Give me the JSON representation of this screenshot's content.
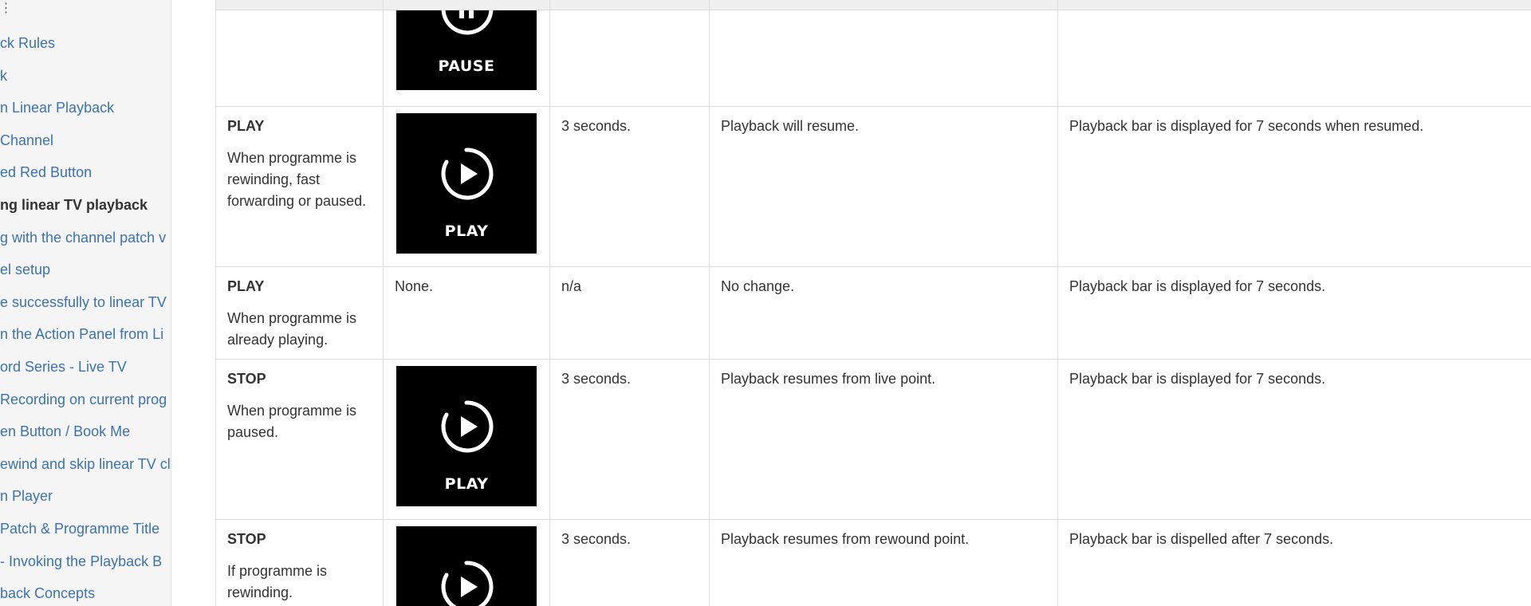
{
  "sidebar": {
    "items": [
      {
        "label": "ck Rules"
      },
      {
        "label": "k"
      },
      {
        "label": "n Linear Playback"
      },
      {
        "label": "Channel"
      },
      {
        "label": "ed Red Button"
      },
      {
        "label": "ng linear TV playback",
        "active": true
      },
      {
        "label": "g with the channel patch v"
      },
      {
        "label": "el setup"
      },
      {
        "label": "e successfully to linear TV"
      },
      {
        "label": "n the Action Panel from Li"
      },
      {
        "label": "ord Series - Live TV"
      },
      {
        "label": "Recording on current prog"
      },
      {
        "label": "en Button / Book Me"
      },
      {
        "label": "ewind and skip linear TV cl"
      },
      {
        "label": "n Player"
      },
      {
        "label": " Patch & Programme Title"
      },
      {
        " label": "",
        "label": " - Invoking the Playback B"
      },
      {
        "label": "back Concepts"
      }
    ],
    "handle": "⋮"
  },
  "table": {
    "rows": [
      {
        "condition_title": "",
        "condition_desc": "",
        "icon": {
          "name": "pause-icon",
          "label": "PAUSE"
        },
        "delay": "",
        "result": "",
        "playback_bar": ""
      },
      {
        "condition_title": "PLAY",
        "condition_desc": "When programme is rewinding, fast forwarding or paused.",
        "icon": {
          "name": "play-icon",
          "label": "PLAY"
        },
        "delay": "3 seconds.",
        "result": "Playback will resume.",
        "playback_bar": "Playback bar is displayed for 7 seconds when resumed."
      },
      {
        "condition_title": "PLAY",
        "condition_desc": "When programme is already playing.",
        "icon_text": "None.",
        "delay": "n/a",
        "result": "No change.",
        "playback_bar": "Playback bar is displayed for 7 seconds."
      },
      {
        "condition_title": "STOP",
        "condition_desc": "When programme is paused.",
        "icon": {
          "name": "play-icon",
          "label": "PLAY"
        },
        "delay": "3 seconds.",
        "result": "Playback resumes from live point.",
        "playback_bar": "Playback bar is displayed for 7 seconds."
      },
      {
        "condition_title": "STOP",
        "condition_desc": "If programme is rewinding.",
        "icon": {
          "name": "play-icon",
          "label": ""
        },
        "delay": "3 seconds.",
        "result": "Playback resumes from rewound point.",
        "playback_bar": "Playback bar is dispelled after 7 seconds."
      }
    ]
  },
  "colors": {
    "link": "#3b73af",
    "text": "#333333",
    "tile_bg": "#000000",
    "border": "#dcdcdc"
  }
}
